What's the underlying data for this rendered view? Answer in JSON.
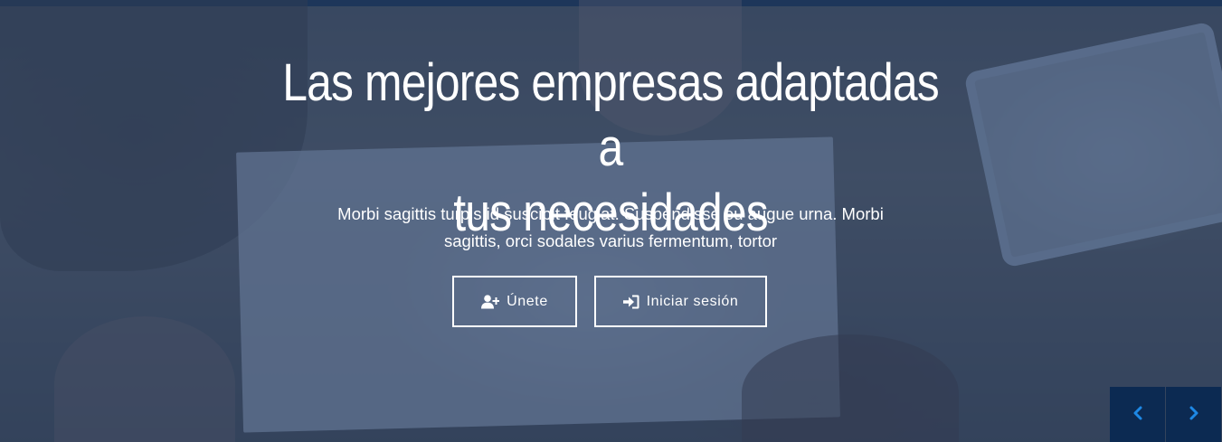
{
  "hero": {
    "headline_line1": "Las mejores empresas adaptadas a",
    "headline_line2": "tus necesidades",
    "subtext_line1": "Morbi sagittis turpis id suscipit feugiat. Suspendisse eu augue urna. Morbi",
    "subtext_line2": "sagittis, orci sodales varius fermentum, tortor",
    "buttons": {
      "join": {
        "label": "Únete",
        "icon": "user-plus-icon"
      },
      "login": {
        "label": "Iniciar sesión",
        "icon": "sign-in-icon"
      }
    }
  },
  "slider": {
    "prev_icon": "chevron-left-icon",
    "next_icon": "chevron-right-icon"
  },
  "colors": {
    "overlay": "#16305c",
    "nav_button_bg": "#0c2a52",
    "nav_arrow": "#1e88e5",
    "text": "#ffffff"
  }
}
